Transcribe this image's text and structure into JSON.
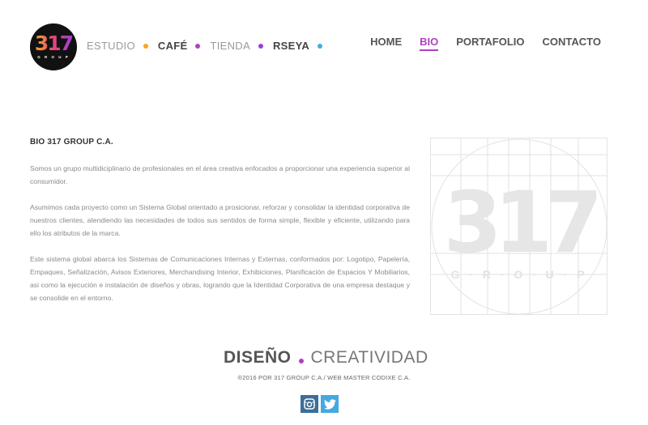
{
  "logo": {
    "number": "317",
    "subtext": "G R O U P"
  },
  "brand_nav": {
    "items": [
      {
        "label": "ESTUDIO",
        "bold": false,
        "dot_color": "#f6a623"
      },
      {
        "label": "CAFÉ",
        "bold": true,
        "dot_color": "#b13fc0"
      },
      {
        "label": "TIENDA",
        "bold": false,
        "dot_color": "#9b3fd6"
      },
      {
        "label": "RSEYA",
        "bold": true,
        "dot_color": "#46a8e0"
      }
    ]
  },
  "main_nav": {
    "items": [
      {
        "label": "HOME",
        "active": false
      },
      {
        "label": "BIO",
        "active": true
      },
      {
        "label": "PORTAFOLIO",
        "active": false
      },
      {
        "label": "CONTACTO",
        "active": false
      }
    ],
    "active_color": "#b13fc0"
  },
  "content": {
    "title": "BIO 317 GROUP C.A.",
    "paragraphs": [
      "Somos un grupo multidiciplinario de profesionales en el área creativa enfocados a proporcionar una experiencia superior al consumidor.",
      "Asumimos cada proyecto como un Sistema Global orientado a prosicionar, reforzar y consolidar la identidad corporativa de nuestros clientes, atendiendo las necesidades de todos sus sentidos de forma simple, flexible y eficiente, utilizando para ello los atributos de la marca.",
      "Este sistema global abarca los Sistemas de Comunicaciones Internas y Externas, conformados por: Logotipo, Papelería, Empaques, Señalización, Avisos Exteriores, Merchandising Interior, Exhibiciones, Planificación de Espacios Y Mobiliarios, asi como la ejecución e instalación de diseños y obras, logrando que la Identidad Corporativa de una empresa destaque y se consolide en el entorno."
    ]
  },
  "figure": {
    "number": "317",
    "subtext": "G · R · O · U · P"
  },
  "footer": {
    "tagline_bold": "DISEÑO",
    "tagline_light": "CREATIVIDAD",
    "copyright": "®2016 POR 317 GROUP C.A./ WEB MASTER CODIXE C.A."
  },
  "social": [
    {
      "name": "instagram",
      "icon": "instagram-icon",
      "color": "#3b6e99"
    },
    {
      "name": "twitter",
      "icon": "twitter-icon",
      "color": "#46a8e0"
    }
  ]
}
